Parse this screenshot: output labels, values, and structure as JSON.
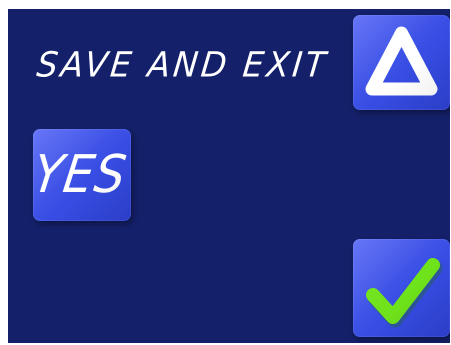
{
  "screen": {
    "background": "#142069",
    "title": "SAVE AND EXIT"
  },
  "buttons": {
    "yes": {
      "label": "YES"
    },
    "up": {
      "icon": "triangle-up-icon"
    },
    "confirm": {
      "icon": "check-icon",
      "icon_color": "#6ee21a"
    }
  },
  "colors": {
    "button": "#3e52e8",
    "text": "#ffffff"
  }
}
